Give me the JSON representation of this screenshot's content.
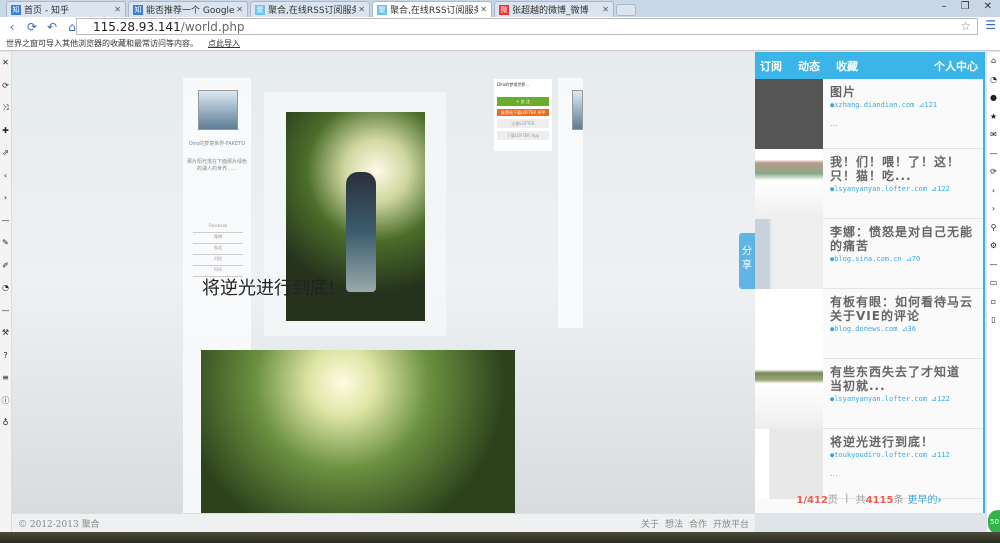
{
  "browser": {
    "tabs": [
      {
        "title": "首页 - 知乎",
        "icon": "知",
        "active": false
      },
      {
        "title": "能否推荐一个 Google Re",
        "icon": "知",
        "active": false
      },
      {
        "title": "聚合,在线RSS订阅服务!",
        "icon": "聚",
        "active": false
      },
      {
        "title": "聚合,在线RSS订阅服务!",
        "icon": "聚",
        "active": true
      },
      {
        "title": "张超越的微博_微博",
        "icon": "微",
        "active": false
      }
    ],
    "url_host": "115.28.93.141",
    "url_path": "/world.php",
    "import_bar": {
      "text": "世界之窗可导入其他浏览器的收藏和最常访问等内容。",
      "link": "点此导入"
    }
  },
  "main": {
    "post_title": "将逆光进行到底!",
    "blog_name": "Diro的梦境世界-FAKETO",
    "blog_desc": "那片阳光落在下面那片绿色的湖人的世界……",
    "side_links": [
      "Facebook",
      "微博",
      "私信",
      "归档",
      "RSS"
    ],
    "lofter": {
      "name": "Diro的梦境世界...",
      "follow": "+ 关 注",
      "orange": "推荐给下载LOFTER APP",
      "register": "注册LOFTER",
      "download": "下载LOFTER App"
    },
    "share_label": "分享"
  },
  "right_panel": {
    "nav": [
      "订阅",
      "动态",
      "收藏"
    ],
    "profile": "个人中心",
    "items": [
      {
        "title": "图片",
        "source": "xzhang.diandian.com",
        "count": "121",
        "excerpt": "..."
      },
      {
        "title": "我！们！喂！了！这！只！猫！吃...",
        "source": "lsyanyanyan.lofter.com",
        "count": "122",
        "excerpt": ""
      },
      {
        "title": "李娜：愤怒是对自己无能的痛苦",
        "source": "blog.sina.com.cn",
        "count": "70",
        "excerpt": ""
      },
      {
        "title": "有板有眼：如何看待马云关于VIE的评论",
        "source": "blog.donews.com",
        "count": "36",
        "excerpt": ""
      },
      {
        "title": "有些东西失去了才知道 当初就...",
        "source": "lsyanyanyan.lofter.com",
        "count": "122",
        "excerpt": ""
      },
      {
        "title": "将逆光进行到底！",
        "source": "toukyoudiro.lofter.com",
        "count": "112",
        "excerpt": "..."
      }
    ],
    "pager": {
      "page": "1/412",
      "page_unit": "页",
      "total_prefix": "共",
      "total": "4115",
      "total_unit": "条",
      "more": "更早的"
    }
  },
  "footer": {
    "copyright": "© 2012-2013 聚合",
    "links": [
      "关于",
      "想法",
      "合作",
      "开放平台"
    ]
  },
  "colors": {
    "accent": "#3bb5e8",
    "highlight": "#f45b4f",
    "follow": "#6aac2b"
  }
}
